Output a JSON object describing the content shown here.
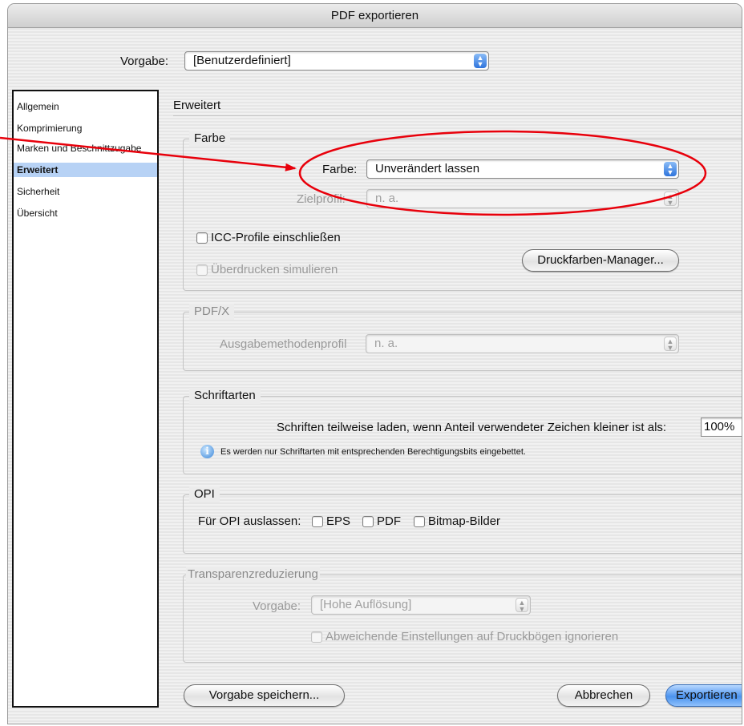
{
  "window": {
    "title": "PDF exportieren"
  },
  "preset": {
    "label": "Vorgabe:",
    "value": "[Benutzerdefiniert]"
  },
  "sidebar": {
    "items": [
      {
        "label": "Allgemein",
        "selected": false
      },
      {
        "label": "Komprimierung",
        "selected": false
      },
      {
        "label": "Marken und Beschnittzugabe",
        "selected": false
      },
      {
        "label": "Erweitert",
        "selected": true
      },
      {
        "label": "Sicherheit",
        "selected": false
      },
      {
        "label": "Übersicht",
        "selected": false
      }
    ]
  },
  "panel": {
    "title": "Erweitert"
  },
  "farbe_group": {
    "title": "Farbe",
    "farbe_label": "Farbe:",
    "farbe_value": "Unverändert lassen",
    "zielprofil_label": "Zielprofil:",
    "zielprofil_value": "n. a.",
    "icc_label": "ICC-Profile einschließen",
    "ueberdrucken_label": "Überdrucken simulieren",
    "druckfarben_button": "Druckfarben-Manager..."
  },
  "pdfx_group": {
    "title": "PDF/X",
    "ausgabe_label": "Ausgabemethodenprofil",
    "ausgabe_value": "n. a."
  },
  "schrift_group": {
    "title": "Schriftarten",
    "subset_label": "Schriften teilweise laden, wenn Anteil verwendeter Zeichen kleiner ist als:",
    "subset_value": "100%",
    "info_text": "Es werden nur Schriftarten mit entsprechenden Berechtigungsbits eingebettet."
  },
  "opi_group": {
    "title": "OPI",
    "omit_label": "Für OPI auslassen:",
    "eps_label": "EPS",
    "pdf_label": "PDF",
    "bitmap_label": "Bitmap-Bilder"
  },
  "transparenz_group": {
    "title": "Transparenzreduzierung",
    "vorgabe_label": "Vorgabe:",
    "vorgabe_value": "[Hohe Auflösung]",
    "ignore_label": "Abweichende Einstellungen auf Druckbögen ignorieren"
  },
  "buttons": {
    "save_preset": "Vorgabe speichern...",
    "cancel": "Abbrechen",
    "export": "Exportieren"
  },
  "colors": {
    "annotation": "#e8000b",
    "selection": "#b7d2f5",
    "accent": "#2e74dc"
  }
}
